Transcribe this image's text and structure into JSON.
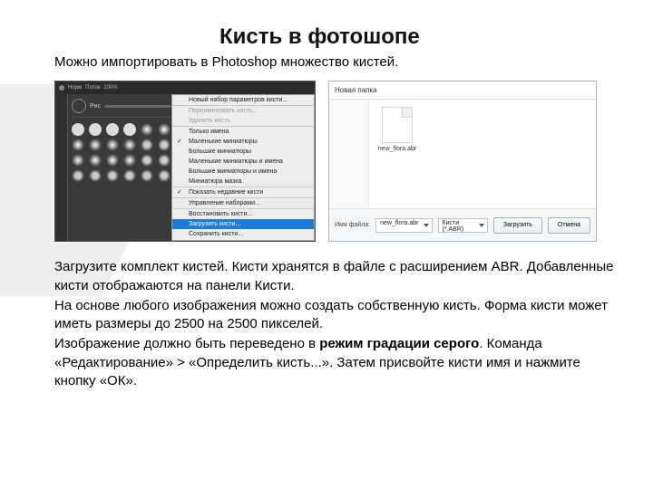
{
  "title": "Кисть в фотошопе",
  "intro": "Можно импортировать в Photoshop множество кистей.",
  "ps": {
    "topbar": {
      "mod": "Норм",
      "flow_lbl": "Поток",
      "pct": "100%"
    },
    "slider_label": "Рис",
    "menu": {
      "new_set": "Новый набор параметров кисти...",
      "rename": "Переименовать кисть...",
      "delete": "Удалить кисть",
      "names_only": "Только имена",
      "small_thumb": "Маленькие миниатюры",
      "large_thumb": "Большие миниатюры",
      "small_list": "Маленькие миниатюры и имена",
      "large_list": "Большие миниатюры и имена",
      "mask_thumb": "Миниатюра мазка",
      "show_recent": "Показать недавние кисти",
      "manage": "Управление наборами...",
      "reset": "Восстановить кисти...",
      "load": "Загрузить кисти...",
      "save": "Сохранить кисти..."
    }
  },
  "dlg": {
    "title": "Новая папка",
    "file_name": "new_flora.abr",
    "fname_label": "Имя файла:",
    "fname_value": "new_flora.abr",
    "type_value": "Кисти (*.ABR)",
    "load_btn": "Загрузить",
    "cancel_btn": "Отмена"
  },
  "body": {
    "p1": "Загрузите комплект кистей. Кисти хранятся в  файле с расширением ABR. Добавленные кисти отображаются на панели Кисти.",
    "p2": "На основе любого изображения можно создать собственную кисть. Форма кисти может иметь размеры до 2500 на 2500 пикселей.",
    "p3a": "Изображение должно быть переведено в ",
    "p3b": "режим градации серого",
    "p3c": ". Команда «Редактирование» > «Определить кисть...». Затем присвойте кисти имя и нажмите кнопку «ОК»."
  }
}
